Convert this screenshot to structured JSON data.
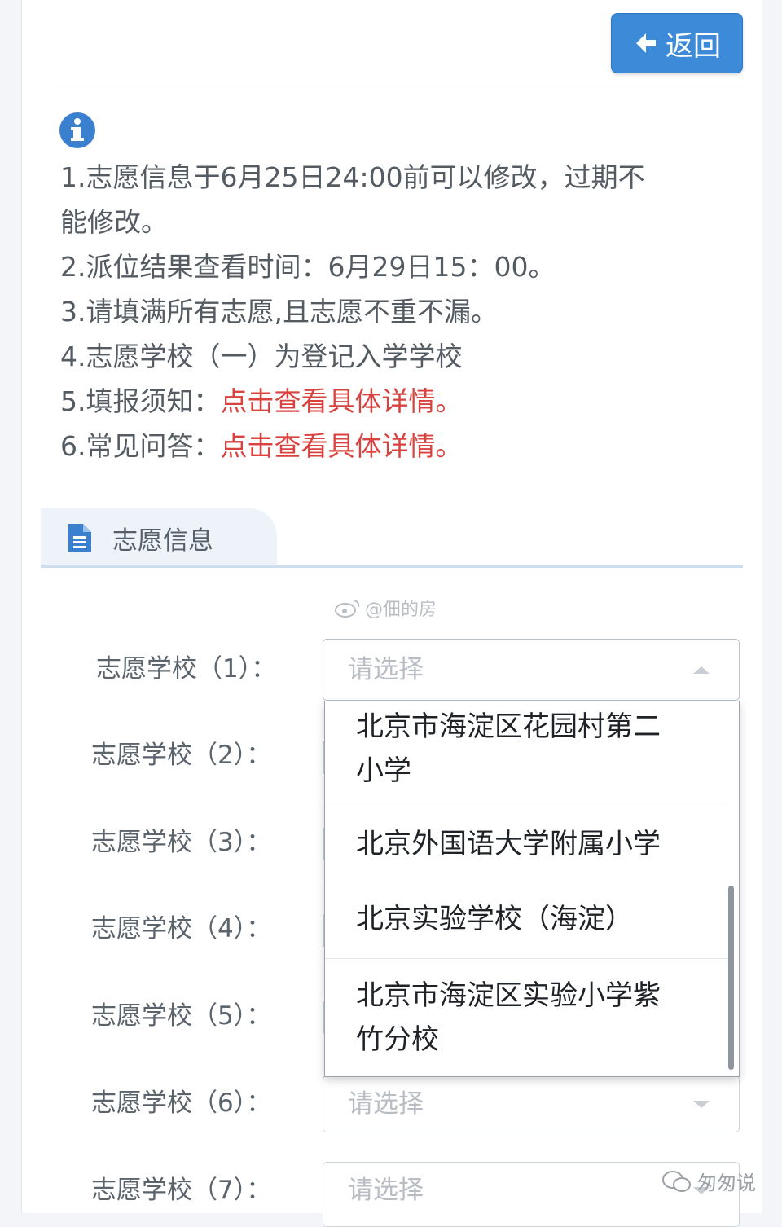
{
  "header": {
    "back_label": "返回"
  },
  "notice": {
    "line1": "1.志愿信息于6月25日24:00前可以修改，过期不",
    "line1b": "能修改。",
    "line2": "2.派位结果查看时间：6月29日15：00。",
    "line3": "3.请填满所有志愿,且志愿不重不漏。",
    "line4": "4.志愿学校（一）为登记入学学校",
    "line5_prefix": "5.填报须知：",
    "line5_link": "点击查看具体详情。",
    "line6_prefix": "6.常见问答：",
    "line6_link": "点击查看具体详情。",
    "link_color": "#d9433f"
  },
  "section": {
    "title": "志愿信息",
    "icon": "document-icon"
  },
  "watermark": {
    "text": "@佃的房"
  },
  "form": {
    "placeholder": "请选择",
    "rows": [
      {
        "label": "志愿学校（1）："
      },
      {
        "label": "志愿学校（2）："
      },
      {
        "label": "志愿学校（3）："
      },
      {
        "label": "志愿学校（4）："
      },
      {
        "label": "志愿学校（5）："
      },
      {
        "label": "志愿学校（6）："
      },
      {
        "label": "志愿学校（7）："
      }
    ]
  },
  "dropdown": {
    "options": [
      {
        "line1": "北京市海淀区花园村第二",
        "line2": "小学"
      },
      {
        "line1": "北京外国语大学附属小学"
      },
      {
        "line1": "北京实验学校（海淀）"
      },
      {
        "line1": "北京市海淀区实验小学紫",
        "line2": "竹分校"
      }
    ]
  },
  "footer": {
    "logo_text": "匆匆说"
  },
  "colors": {
    "primary": "#3d8bd8",
    "info_icon": "#3b7fcf"
  }
}
